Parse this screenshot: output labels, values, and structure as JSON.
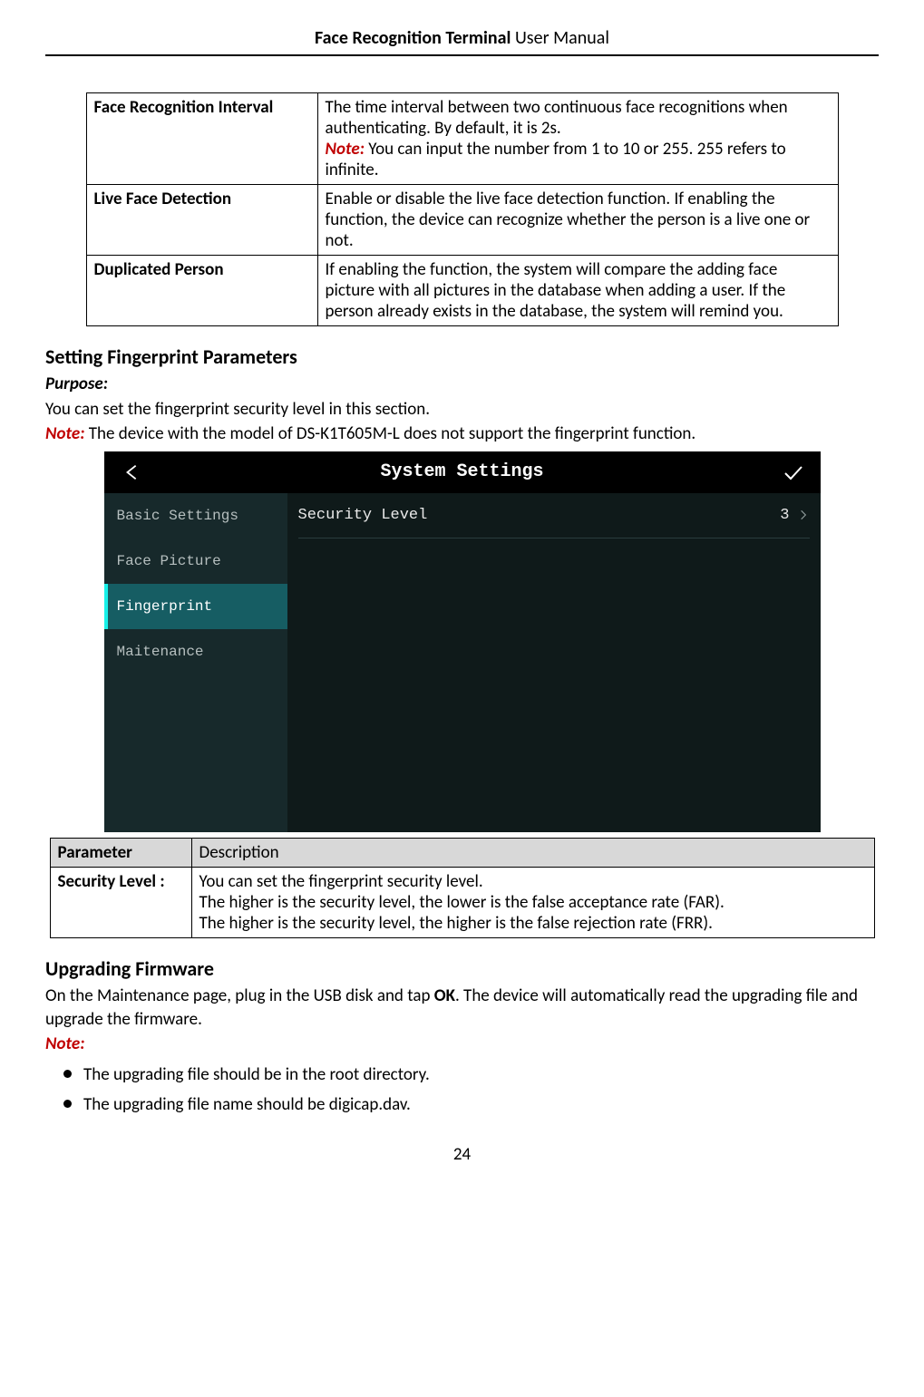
{
  "header": {
    "title_bold": "Face Recognition Terminal",
    "title_rest": "  User Manual"
  },
  "table1": {
    "rows": [
      {
        "name": "Face Recognition Interval",
        "desc_pre": "The time interval between two continuous face recognitions when authenticating. By default, it is 2s.",
        "note_label": "Note:",
        "note_text": " You can input the number from 1 to 10 or 255. 255 refers to infinite."
      },
      {
        "name": "Live Face Detection",
        "desc": "Enable or disable the live face detection function. If enabling the function, the device can recognize whether the person is a live one or not."
      },
      {
        "name": "Duplicated Person",
        "desc": "If enabling the function, the system will compare the adding face picture with all pictures in the database when adding a user. If the person already exists in the database, the system will remind you."
      }
    ]
  },
  "sec_fp": {
    "heading": "Setting Fingerprint Parameters",
    "purpose_label": "Purpose:",
    "purpose_text": "You can set the fingerprint security level in this section.",
    "note_label": "Note:",
    "note_text": " The device with the model of DS-K1T605M-L does not support the fingerprint function."
  },
  "device": {
    "title": "System Settings",
    "side": [
      "Basic Settings",
      "Face Picture",
      "Fingerprint",
      "Maitenance"
    ],
    "row_label": "Security Level",
    "row_value": "3"
  },
  "table2": {
    "h1": "Parameter",
    "h2": "Description",
    "row_name": "Security Level :",
    "row_desc_l1": "You can set the fingerprint security level.",
    "row_desc_l2": "The higher is the security level, the lower is the false acceptance rate (FAR).",
    "row_desc_l3": "The higher is the security level, the higher is the false rejection rate (FRR)."
  },
  "sec_upg": {
    "heading": "Upgrading Firmware",
    "text_pre": "On the Maintenance page, plug in the USB disk and tap ",
    "ok": "OK",
    "text_post": ". The device will automatically read the upgrading file and upgrade the firmware.",
    "note_label": "Note:",
    "b1": "The upgrading file should be in the root directory.",
    "b2": "The upgrading file name should be digicap.dav."
  },
  "page_number": "24"
}
